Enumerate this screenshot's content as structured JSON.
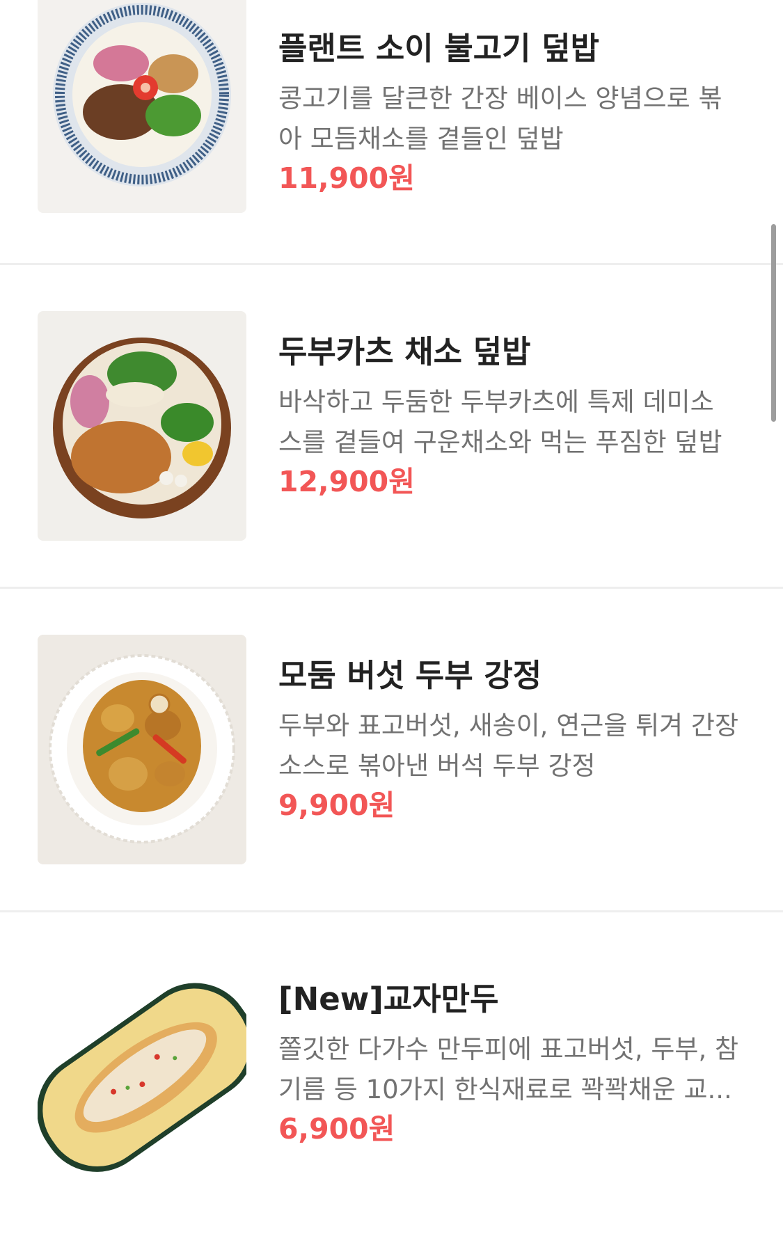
{
  "menu": {
    "items": [
      {
        "name": "플랜트 소이 불고기 덮밥",
        "desc_line1": "콩고기를 달큰한 간장 베이스 양념으로 볶",
        "desc_line2": "아 모듬채소를 곁들인 덮밥",
        "price": "11,900원",
        "image_icon": "bulgogi-rice-bowl-photo"
      },
      {
        "name": "두부카츠 채소 덮밥",
        "desc_line1": "바삭하고 두둠한 두부카츠에 특제 데미소",
        "desc_line2": "스를 곁들여 구운채소와 먹는 푸짐한 덮밥",
        "price": "12,900원",
        "image_icon": "tofu-katsu-bowl-photo"
      },
      {
        "name": "모둠 버섯 두부 강정",
        "desc_line1": "두부와 표고버섯, 새송이, 연근을 튀겨 간장",
        "desc_line2": "소스로 볶아낸 버석 두부 강정",
        "price": "9,900원",
        "image_icon": "mushroom-tofu-gangjeong-photo"
      },
      {
        "name": "[New]교자만두",
        "desc_line1": "쫄깃한 다가수 만두피에 표고버섯, 두부, 참",
        "desc_line2": "기름 등 10가지 한식재료로 꽉꽉채운 교...",
        "price": "6,900원",
        "image_icon": "gyoza-dumpling-photo"
      }
    ]
  },
  "colors": {
    "price": "#f25656",
    "title": "#222222",
    "description": "#727272",
    "divider": "#eeeeee"
  }
}
